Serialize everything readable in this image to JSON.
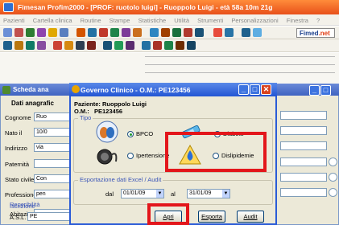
{
  "app": {
    "title": "Fimesan Profim2000 - [PROF: ruotolo luigi] - Ruoppolo Luigi - età 58a 10m 21g"
  },
  "menu": [
    "Pazienti",
    "Cartella clinica",
    "Routine",
    "Stampe",
    "Statistiche",
    "Utilità",
    "Strumenti",
    "Personalizzazioni",
    "Finestra",
    "?"
  ],
  "brand": {
    "part1": "Fimed",
    "part2": ".net"
  },
  "scheda": {
    "title": "Scheda ana",
    "section": "Dati anagrafic",
    "fields": [
      {
        "label": "Cognome",
        "value": "Ruo"
      },
      {
        "label": "Nato il",
        "value": "10/0"
      },
      {
        "label": "Indirizzo",
        "value": "via"
      },
      {
        "label": "Paternità",
        "value": ""
      },
      {
        "label": "Stato civile",
        "value": "Con"
      },
      {
        "label": "Professione",
        "value": "pen"
      }
    ],
    "subgroup1": "Reperibilità",
    "abitazione": "Abitazione",
    "subgroup2": "Iscrizione",
    "asl_label": "A.S.L.",
    "asl_value": "PE"
  },
  "dialog": {
    "title": "Governo Clinico - O.M.: PE123456",
    "patient_label": "Paziente: Ruoppolo Luigi",
    "om_label": "O.M.:",
    "om_value": "PE123456",
    "tipo_label": "Tipo",
    "options": [
      {
        "label": "BPCO",
        "selected": true
      },
      {
        "label": "Diabete",
        "selected": false
      },
      {
        "label": "Ipertensione",
        "selected": false
      },
      {
        "label": "Dislipidemie",
        "selected": false
      }
    ],
    "export_label": "Esportazione dati Excel / Audit",
    "dal_label": "dal",
    "dal_value": "01/01/09",
    "al_label": "al",
    "al_value": "31/01/09",
    "buttons": {
      "apri": "Apri",
      "esporta": "Esporta",
      "audit": "Audit"
    }
  },
  "accent": {
    "dialog_title": "#2255d4",
    "highlight": "#e3161b",
    "titlebar": "#e8501a"
  }
}
